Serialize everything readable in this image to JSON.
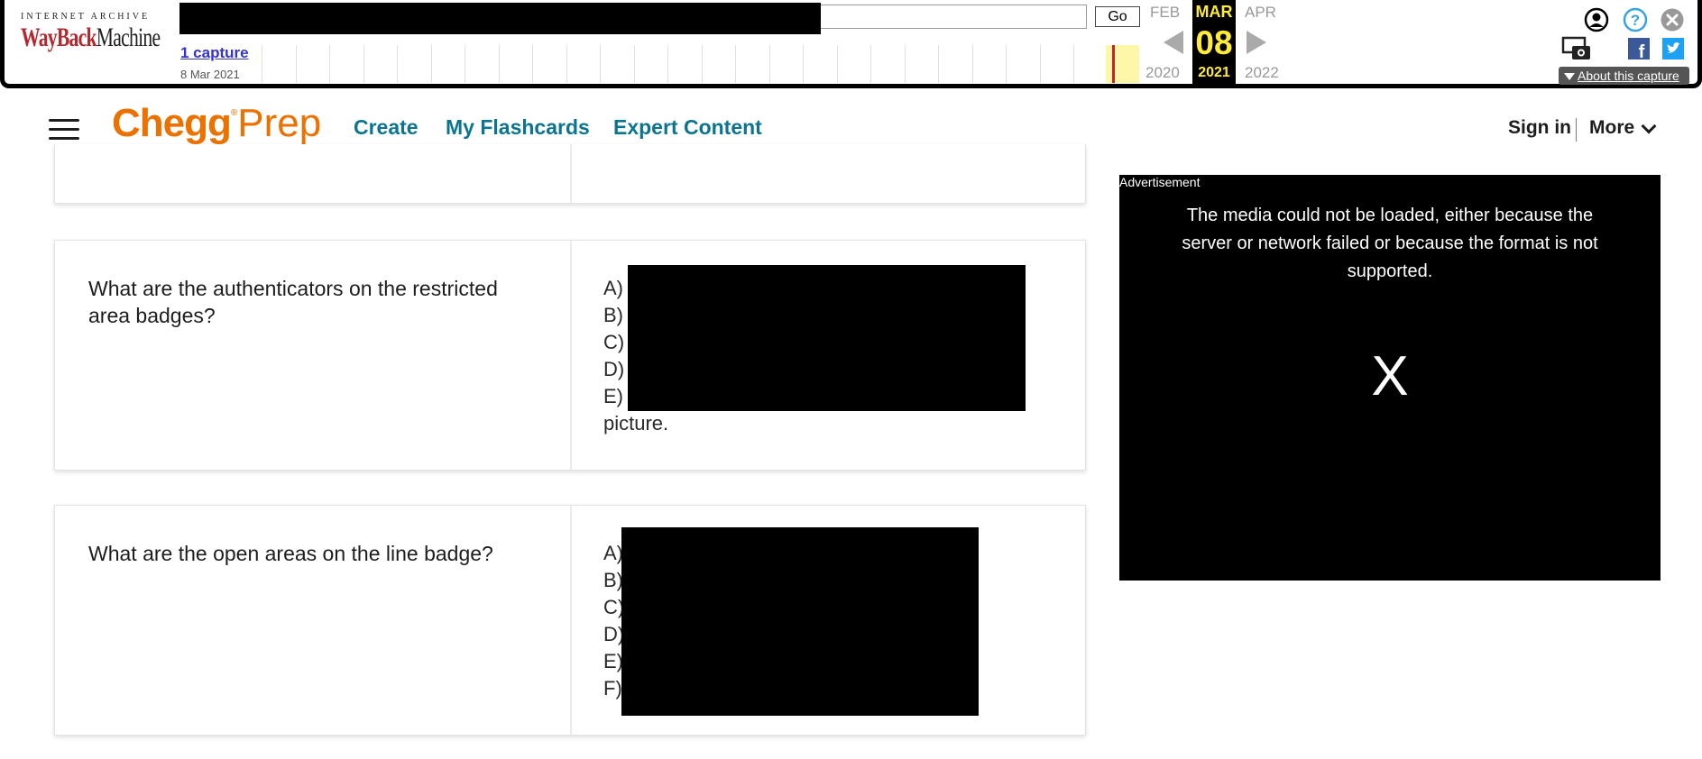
{
  "wayback": {
    "logo_top": "INTERNET ARCHIVE",
    "logo_way": "WayBack",
    "logo_machine": "Machine",
    "go_label": "Go",
    "captures_link": "1 capture",
    "capture_date": "8 Mar 2021",
    "prev_month": "FEB",
    "current_month": "MAR",
    "next_month": "APR",
    "current_day": "08",
    "prev_year": "2020",
    "current_year": "2021",
    "next_year": "2022",
    "about_label": "About this capture",
    "icons": [
      "user-icon",
      "help-icon",
      "close-icon",
      "screenshot-icon",
      "facebook-icon",
      "twitter-icon"
    ]
  },
  "header": {
    "logo_chegg": "Chegg",
    "logo_reg": "®",
    "logo_prep": "Prep",
    "nav": [
      "Create",
      "My Flashcards",
      "Expert Content"
    ],
    "sign_in": "Sign in",
    "more": "More"
  },
  "cards": [
    {
      "question": "What are the authenticators on the restricted area badges?",
      "answer_lines": [
        "A)",
        "B)",
        "C)",
        "D)",
        "E)",
        "picture."
      ]
    },
    {
      "question": "What are the open areas on the line badge?",
      "answer_lines": [
        "A)",
        "B)",
        "C)",
        "D)",
        "E)",
        "F)"
      ]
    }
  ],
  "ad": {
    "label": "Advertisement",
    "message": "The media could not be loaded, either because the server or network failed or because the format is not supported.",
    "close_glyph": "X"
  },
  "colors": {
    "chegg_orange": "#eb7100",
    "nav_teal": "#0c7490",
    "wayback_yellow": "#ffeb3b"
  }
}
